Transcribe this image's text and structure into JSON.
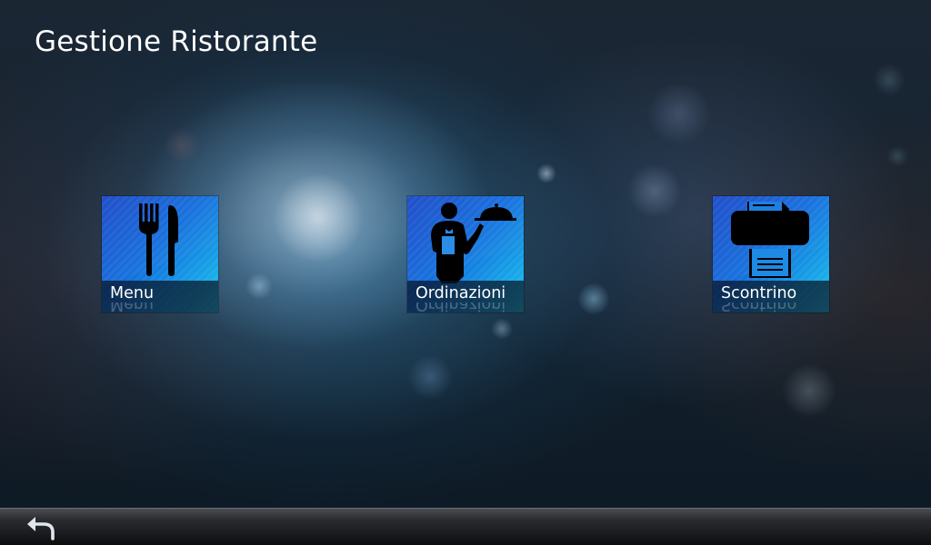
{
  "app": {
    "title": "Gestione Ristorante"
  },
  "tiles": [
    {
      "label": "Menu",
      "icon": "fork-knife-icon"
    },
    {
      "label": "Ordinazioni",
      "icon": "waiter-icon"
    },
    {
      "label": "Scontrino",
      "icon": "printer-icon"
    }
  ],
  "navigation": {
    "back_icon": "back-arrow-icon"
  },
  "colors": {
    "tile_gradient_start": "#0a3cc4",
    "tile_gradient_end": "#2cd3f4",
    "caption_bar": "#0a1423",
    "text": "#ffffff",
    "bottom_bar": "#2a2c30"
  }
}
